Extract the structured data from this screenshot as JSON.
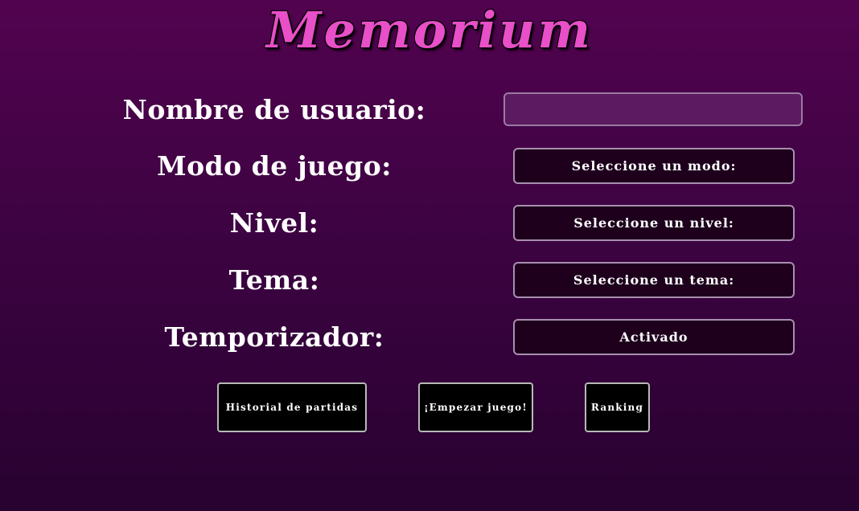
{
  "app": {
    "title": "Memorium"
  },
  "form": {
    "username": {
      "label": "Nombre de usuario:",
      "value": "",
      "placeholder": ""
    },
    "mode": {
      "label": "Modo de juego:",
      "selected": "Seleccione un modo:"
    },
    "level": {
      "label": "Nivel:",
      "selected": "Seleccione un nivel:"
    },
    "theme": {
      "label": "Tema:",
      "selected": "Seleccione un tema:"
    },
    "timer": {
      "label": "Temporizador:",
      "selected": "Activado"
    }
  },
  "buttons": {
    "history": "Historial de partidas",
    "start": "¡Empezar juego!",
    "ranking": "Ranking"
  },
  "colors": {
    "background_top": "#52034f",
    "background_bottom": "#280230",
    "title_pink": "#e84fc8",
    "select_background": "#1e001d",
    "input_background": "#5c1a60"
  }
}
